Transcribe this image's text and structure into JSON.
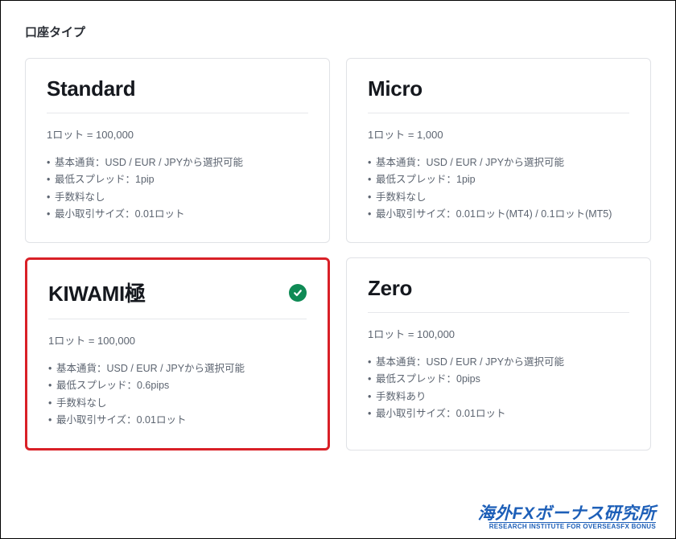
{
  "title": "口座タイプ",
  "cards": [
    {
      "name": "Standard",
      "lot": "1ロット = 100,000",
      "features": [
        "基本通貨：USD / EUR / JPYから選択可能",
        "最低スプレッド：1pip",
        "手数料なし",
        "最小取引サイズ：0.01ロット"
      ],
      "selected": false,
      "highlighted": false
    },
    {
      "name": "Micro",
      "lot": "1ロット = 1,000",
      "features": [
        "基本通貨：USD / EUR / JPYから選択可能",
        "最低スプレッド：1pip",
        "手数料なし",
        "最小取引サイズ：0.01ロット(MT4) / 0.1ロット(MT5)"
      ],
      "selected": false,
      "highlighted": false
    },
    {
      "name": "KIWAMI極",
      "lot": "1ロット = 100,000",
      "features": [
        "基本通貨：USD / EUR / JPYから選択可能",
        "最低スプレッド：0.6pips",
        "手数料なし",
        "最小取引サイズ：0.01ロット"
      ],
      "selected": true,
      "highlighted": true
    },
    {
      "name": "Zero",
      "lot": "1ロット = 100,000",
      "features": [
        "基本通貨：USD / EUR / JPYから選択可能",
        "最低スプレッド：0pips",
        "手数料あり",
        "最小取引サイズ：0.01ロット"
      ],
      "selected": false,
      "highlighted": false
    }
  ],
  "brand": {
    "main": "海外FXボーナス研究所",
    "sub": "RESEARCH INSTITUTE FOR OVERSEASFX BONUS"
  }
}
